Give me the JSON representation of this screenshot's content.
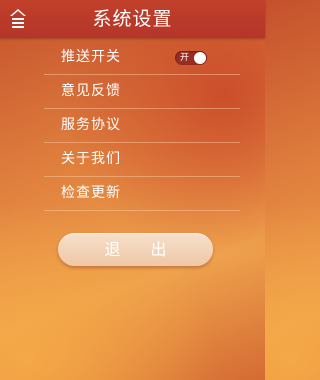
{
  "header": {
    "title": "系统设置",
    "home_icon": "home-icon"
  },
  "menu": {
    "items": [
      {
        "label": "推送开关"
      },
      {
        "label": "意见反馈"
      },
      {
        "label": "服务协议"
      },
      {
        "label": "关于我们"
      },
      {
        "label": "检查更新"
      }
    ],
    "push_toggle": {
      "state_text": "开",
      "on": true
    }
  },
  "logout": {
    "label": "退出"
  },
  "colors": {
    "header_bg": "#b5352a",
    "button_bg": "#efc7a6",
    "toggle_bg": "#9a2d22",
    "text": "#ffffff"
  }
}
